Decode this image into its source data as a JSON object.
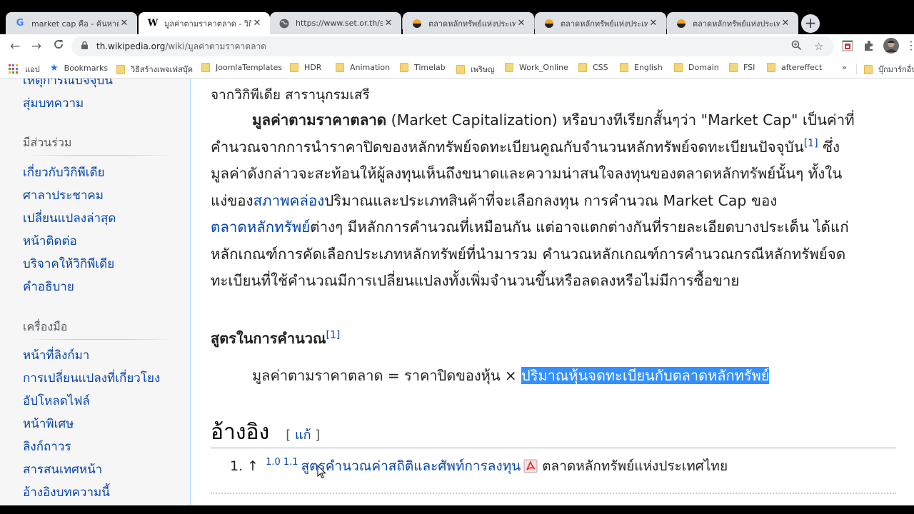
{
  "browser": {
    "tabs": [
      {
        "favicon": "google-icon",
        "title": "market cap คือ - ค้นหาด้วย Google",
        "active": false
      },
      {
        "favicon": "wikipedia-icon",
        "title": "มูลค่าตามราคาตลาด - วิกิพีเดีย",
        "active": true
      },
      {
        "favicon": "globe-icon",
        "title": "https://www.set.or.th/set/",
        "active": false
      },
      {
        "favicon": "set-logo-icon",
        "title": "ตลาดหลักทรัพย์แห่งประเทศไทย",
        "active": false
      },
      {
        "favicon": "set-logo-icon",
        "title": "ตลาดหลักทรัพย์แห่งประเทศไทย",
        "active": false
      },
      {
        "favicon": "set-logo-icon",
        "title": "ตลาดหลักทรัพย์แห่งประเทศไทย",
        "active": false
      }
    ],
    "close_glyph": "✕",
    "new_tab_glyph": "+",
    "url_host": "th.wikipedia.org",
    "url_path": "/wiki/มูลค่าตามราคาตลาด",
    "bookmarks": {
      "apps_label": "แอป",
      "items": [
        "Bookmarks",
        "วิธีสร้างเพจเฟสบุ๊ค",
        "JoomlaTemplates",
        "HDR",
        "Animation",
        "Timelab",
        "เพริษญ",
        "Work_Online",
        "CSS",
        "English",
        "Domain",
        "FSI",
        "aftereffect"
      ],
      "overflow": "»",
      "other": "บุ๊กมาร์กอื่นๆ"
    }
  },
  "sidebar": {
    "partial_top": "เหตุการณ์ปัจจุบัน",
    "random": "สุ่มบทความ",
    "participate_heading": "มีส่วนร่วม",
    "participate": [
      "เกี่ยวกับวิกิพีเดีย",
      "ศาลาประชาคม",
      "เปลี่ยนแปลงล่าสุด",
      "หน้าติดต่อ",
      "บริจาคให้วิกิพีเดีย",
      "คำอธิบาย"
    ],
    "tools_heading": "เครื่องมือ",
    "tools": [
      "หน้าที่ลิงก์มา",
      "การเปลี่ยนแปลงที่เกี่ยวโยง",
      "อัปโหลดไฟล์",
      "หน้าพิเศษ",
      "ลิงก์ถาวร",
      "สารสนเทศหน้า",
      "อ้างอิงบทความนี้"
    ]
  },
  "article": {
    "tagline": "จากวิกิพีเดีย สารานุกรมเสรี",
    "lead": {
      "bold_term": "มูลค่าตามราคาตลาด",
      "l1_rest": " (Market Capitalization) หรือบางทีเรียกสั้นๆว่า \"Market Cap\" เป็นค่าที่",
      "l2": "คำนวณจากการนำราคาปิดของหลักทรัพย์จดทะเบียนคูณกับจำนวนหลักทรัพย์จดทะเบียนปัจจุบัน",
      "l2_ref": "[1]",
      "l2_end": " ซึ่ง",
      "l3": "มูลค่าดังกล่าวจะสะท้อนให้ผู้ลงทุนเห็นถึงขนาดและความน่าสนใจลงทุนของตลาดหลักทรัพย์นั้นๆ ทั้งใน",
      "l4_pre": "แง่ของ",
      "l4_link": "สภาพคล่อง",
      "l4_rest": "ปริมาณและประเภทสินค้าที่จะเลือกลงทุน การคำนวณ Market Cap ของ",
      "l5_link": "ตลาดหลักทรัพย์",
      "l5_rest": "ต่างๆ มีหลักการคำนวณที่เหมือนกัน แต่อาจแตกต่างกันที่รายละเอียดบางประเด็น ได้แก่",
      "l6": "หลักเกณฑ์การคัดเลือกประเภทหลักทรัพย์ที่นำมารวม คำนวณหลักเกณฑ์การคำนวณกรณีหลักทรัพย์จด",
      "l7": "ทะเบียนที่ใช้คำนวณมีการเปลี่ยนแปลงทั้งเพิ่มจำนวนขึ้นหรือลดลงหรือไม่มีการซื้อขาย"
    },
    "formula_heading": "สูตรในการคำนวณ",
    "formula_ref": "[1]",
    "formula_left": "มูลค่าตามราคาตลาด = ราคาปิดของหุ้น × ",
    "formula_selected": "ปริมาณหุ้นจดทะเบียนกับตลาดหลักทรัพย์",
    "references_heading": "อ้างอิง",
    "edit_open": "[ ",
    "edit_label": "แก้",
    "edit_close": " ]",
    "ref1": {
      "number": "1. ↑",
      "backlinks": "1.0 1.1",
      "link": "สูตรคำนวณค่าสถิติและศัพท์การลงทุน",
      "publisher": "ตลาดหลักทรัพย์แห่งประเทศไทย"
    }
  }
}
